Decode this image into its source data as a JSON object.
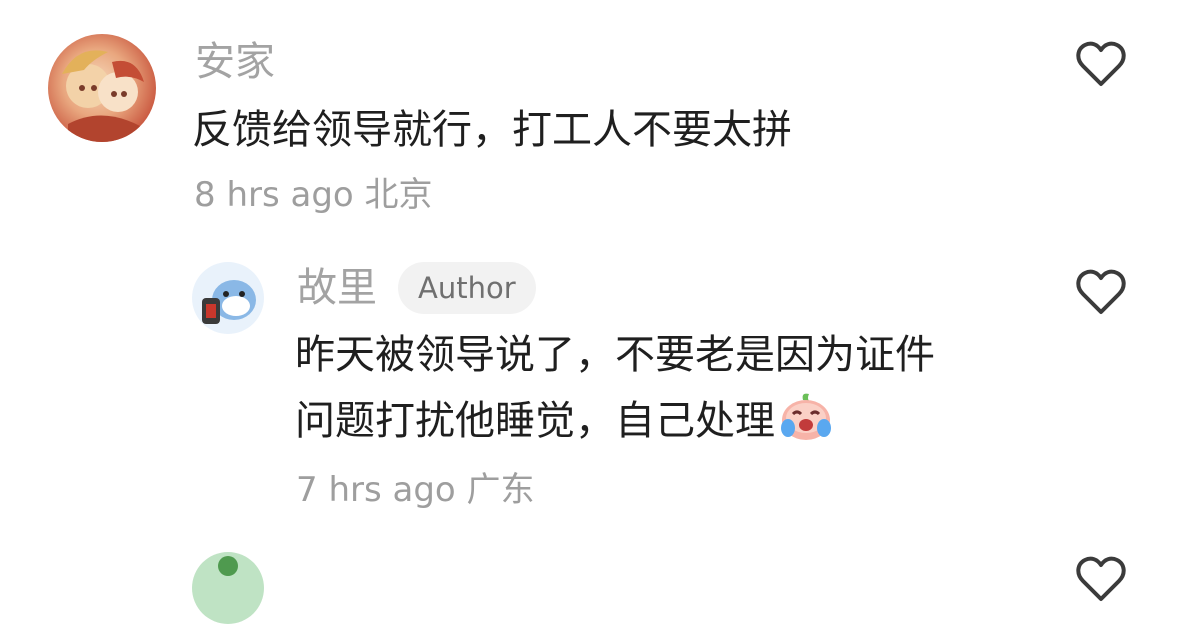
{
  "comments": [
    {
      "username": "安家",
      "text": "反馈给领导就行，打工人不要太拼",
      "time": "8 hrs ago",
      "location": "北京"
    },
    {
      "username": "故里",
      "badge": "Author",
      "text_line1": "昨天被领导说了，不要老是因为证件",
      "text_line2": "问题打扰他睡觉，自己处理",
      "time": "7 hrs ago",
      "location": "广东"
    }
  ],
  "colors": {
    "text": "#1f1f1f",
    "muted": "#a3a3a3",
    "badge_bg": "#f2f2f2"
  },
  "icons": [
    "heart-outline-icon",
    "crying-emoji-icon"
  ]
}
